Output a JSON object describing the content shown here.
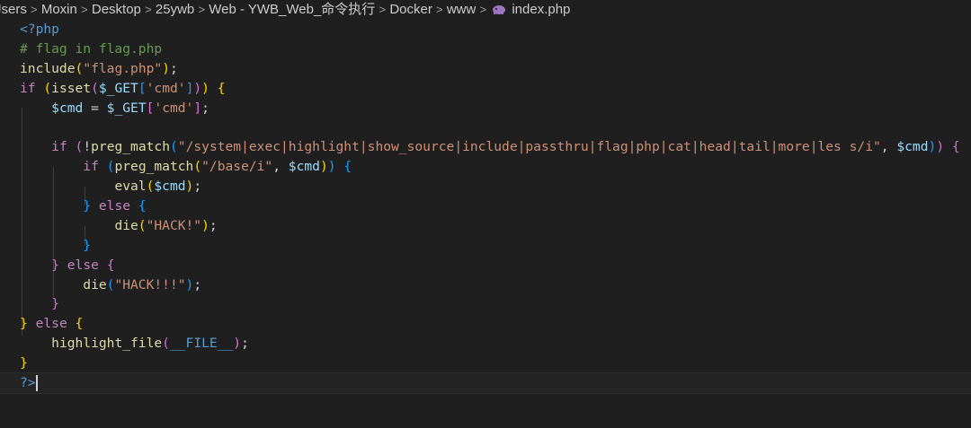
{
  "breadcrumb": {
    "segments": [
      "Jsers",
      "Moxin",
      "Desktop",
      "25ywb",
      "Web - YWB_Web_命令执行",
      "Docker",
      "www"
    ],
    "file": "index.php",
    "separator": ">",
    "file_icon": "php-elephant-icon"
  },
  "editor": {
    "language": "php",
    "current_line": 19,
    "lines": [
      [
        {
          "t": "<?php",
          "c": "tag"
        }
      ],
      [
        {
          "t": "# flag in flag.php",
          "c": "comment"
        }
      ],
      [
        {
          "t": "include",
          "c": "fn"
        },
        {
          "t": "(",
          "c": "b1"
        },
        {
          "t": "\"flag.php\"",
          "c": "str"
        },
        {
          "t": ")",
          "c": "b1"
        },
        {
          "t": ";",
          "c": "p"
        }
      ],
      [
        {
          "t": "if",
          "c": "kw"
        },
        {
          "t": " ",
          "c": "p"
        },
        {
          "t": "(",
          "c": "b1"
        },
        {
          "t": "isset",
          "c": "fn"
        },
        {
          "t": "(",
          "c": "b2"
        },
        {
          "t": "$_GET",
          "c": "var"
        },
        {
          "t": "[",
          "c": "b3"
        },
        {
          "t": "'cmd'",
          "c": "str"
        },
        {
          "t": "]",
          "c": "b3"
        },
        {
          "t": ")",
          "c": "b2"
        },
        {
          "t": ")",
          "c": "b1"
        },
        {
          "t": " ",
          "c": "p"
        },
        {
          "t": "{",
          "c": "b1"
        }
      ],
      [
        {
          "t": "    ",
          "c": "p"
        },
        {
          "t": "$cmd",
          "c": "var"
        },
        {
          "t": " = ",
          "c": "p"
        },
        {
          "t": "$_GET",
          "c": "var"
        },
        {
          "t": "[",
          "c": "b2"
        },
        {
          "t": "'cmd'",
          "c": "str"
        },
        {
          "t": "]",
          "c": "b2"
        },
        {
          "t": ";",
          "c": "p"
        }
      ],
      [],
      [
        {
          "t": "    ",
          "c": "p"
        },
        {
          "t": "if",
          "c": "kw"
        },
        {
          "t": " ",
          "c": "p"
        },
        {
          "t": "(",
          "c": "b2"
        },
        {
          "t": "!",
          "c": "p"
        },
        {
          "t": "preg_match",
          "c": "fn"
        },
        {
          "t": "(",
          "c": "b3"
        },
        {
          "t": "\"/system|exec|highlight|show_source|include|passthru|flag|php|cat|head|tail|more|les s/i\"",
          "c": "str"
        },
        {
          "t": ", ",
          "c": "p"
        },
        {
          "t": "$cmd",
          "c": "var"
        },
        {
          "t": ")",
          "c": "b3"
        },
        {
          "t": ")",
          "c": "b2"
        },
        {
          "t": " ",
          "c": "p"
        },
        {
          "t": "{",
          "c": "b2"
        }
      ],
      [
        {
          "t": "        ",
          "c": "p"
        },
        {
          "t": "if",
          "c": "kw"
        },
        {
          "t": " ",
          "c": "p"
        },
        {
          "t": "(",
          "c": "b3"
        },
        {
          "t": "preg_match",
          "c": "fn"
        },
        {
          "t": "(",
          "c": "b1"
        },
        {
          "t": "\"/base/i\"",
          "c": "str"
        },
        {
          "t": ", ",
          "c": "p"
        },
        {
          "t": "$cmd",
          "c": "var"
        },
        {
          "t": ")",
          "c": "b1"
        },
        {
          "t": ")",
          "c": "b3"
        },
        {
          "t": " ",
          "c": "p"
        },
        {
          "t": "{",
          "c": "b3"
        }
      ],
      [
        {
          "t": "            ",
          "c": "p"
        },
        {
          "t": "eval",
          "c": "fn"
        },
        {
          "t": "(",
          "c": "b1"
        },
        {
          "t": "$cmd",
          "c": "var"
        },
        {
          "t": ")",
          "c": "b1"
        },
        {
          "t": ";",
          "c": "p"
        }
      ],
      [
        {
          "t": "        ",
          "c": "p"
        },
        {
          "t": "}",
          "c": "b3"
        },
        {
          "t": " ",
          "c": "p"
        },
        {
          "t": "else",
          "c": "kw"
        },
        {
          "t": " ",
          "c": "p"
        },
        {
          "t": "{",
          "c": "b3"
        }
      ],
      [
        {
          "t": "            ",
          "c": "p"
        },
        {
          "t": "die",
          "c": "fn"
        },
        {
          "t": "(",
          "c": "b1"
        },
        {
          "t": "\"HACK!\"",
          "c": "str"
        },
        {
          "t": ")",
          "c": "b1"
        },
        {
          "t": ";",
          "c": "p"
        }
      ],
      [
        {
          "t": "        ",
          "c": "p"
        },
        {
          "t": "}",
          "c": "b3"
        }
      ],
      [
        {
          "t": "    ",
          "c": "p"
        },
        {
          "t": "}",
          "c": "b2"
        },
        {
          "t": " ",
          "c": "p"
        },
        {
          "t": "else",
          "c": "kw"
        },
        {
          "t": " ",
          "c": "p"
        },
        {
          "t": "{",
          "c": "b2"
        }
      ],
      [
        {
          "t": "        ",
          "c": "p"
        },
        {
          "t": "die",
          "c": "fn"
        },
        {
          "t": "(",
          "c": "b3"
        },
        {
          "t": "\"HACK!!!\"",
          "c": "str"
        },
        {
          "t": ")",
          "c": "b3"
        },
        {
          "t": ";",
          "c": "p"
        }
      ],
      [
        {
          "t": "    ",
          "c": "p"
        },
        {
          "t": "}",
          "c": "b2"
        }
      ],
      [
        {
          "t": "}",
          "c": "b1"
        },
        {
          "t": " ",
          "c": "p"
        },
        {
          "t": "else",
          "c": "kw"
        },
        {
          "t": " ",
          "c": "p"
        },
        {
          "t": "{",
          "c": "b1"
        }
      ],
      [
        {
          "t": "    ",
          "c": "p"
        },
        {
          "t": "highlight_file",
          "c": "fn"
        },
        {
          "t": "(",
          "c": "b2"
        },
        {
          "t": "__FILE__",
          "c": "const"
        },
        {
          "t": ")",
          "c": "b2"
        },
        {
          "t": ";",
          "c": "p"
        }
      ],
      [
        {
          "t": "}",
          "c": "b1"
        }
      ],
      [
        {
          "t": "?>",
          "c": "tag"
        }
      ]
    ]
  },
  "colors": {
    "background": "#1f1f1f",
    "tag": "#569cd6",
    "comment": "#6a9955",
    "function": "#dcdcaa",
    "string": "#ce9178",
    "variable": "#9cdcfe",
    "keyword": "#c586c0",
    "bracket_level_1": "#ffd700",
    "bracket_level_2": "#da70d6",
    "bracket_level_3": "#179fff"
  }
}
